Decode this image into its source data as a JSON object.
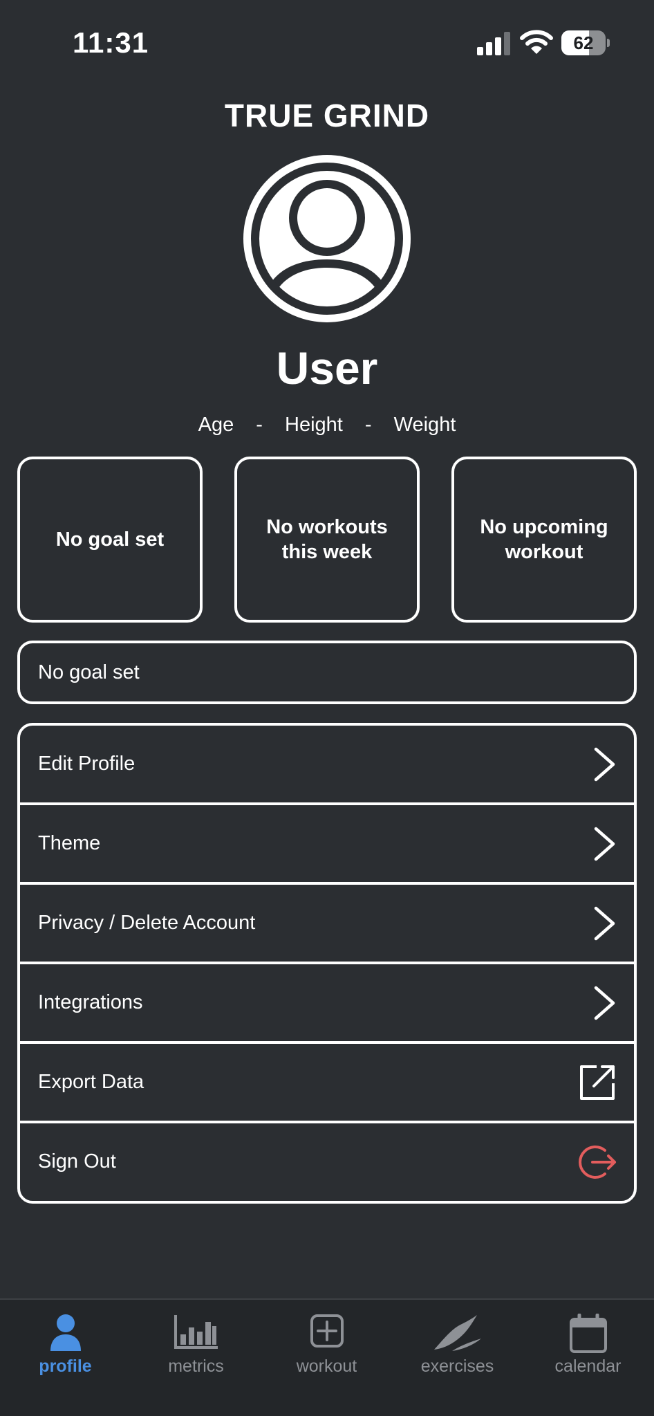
{
  "status_bar": {
    "time": "11:31",
    "battery_percent": 62
  },
  "header": {
    "app_title": "TRUE GRIND",
    "user_name": "User",
    "age_label": "Age",
    "height_label": "Height",
    "weight_label": "Weight",
    "separator": "-"
  },
  "cards": [
    {
      "text": "No goal set"
    },
    {
      "text": "No workouts this week"
    },
    {
      "text": "No upcoming workout"
    }
  ],
  "goal": {
    "text": "No goal set"
  },
  "menu": {
    "items": [
      {
        "label": "Edit Profile",
        "icon": "chevron-right-icon"
      },
      {
        "label": "Theme",
        "icon": "chevron-right-icon"
      },
      {
        "label": "Privacy / Delete Account",
        "icon": "chevron-right-icon"
      },
      {
        "label": "Integrations",
        "icon": "chevron-right-icon"
      },
      {
        "label": "Export Data",
        "icon": "export-icon"
      },
      {
        "label": "Sign Out",
        "icon": "sign-out-icon"
      }
    ]
  },
  "tabs": [
    {
      "label": "profile",
      "icon": "person-icon",
      "active": true
    },
    {
      "label": "metrics",
      "icon": "bar-chart-icon",
      "active": false
    },
    {
      "label": "workout",
      "icon": "plus-square-icon",
      "active": false
    },
    {
      "label": "exercises",
      "icon": "feather-icon",
      "active": false
    },
    {
      "label": "calendar",
      "icon": "calendar-icon",
      "active": false
    }
  ],
  "colors": {
    "background": "#2b2e32",
    "tab_bar": "#232629",
    "accent_active": "#4a90e2",
    "inactive": "#8e9196",
    "sign_out": "#e35d5d",
    "foreground": "#ffffff"
  }
}
